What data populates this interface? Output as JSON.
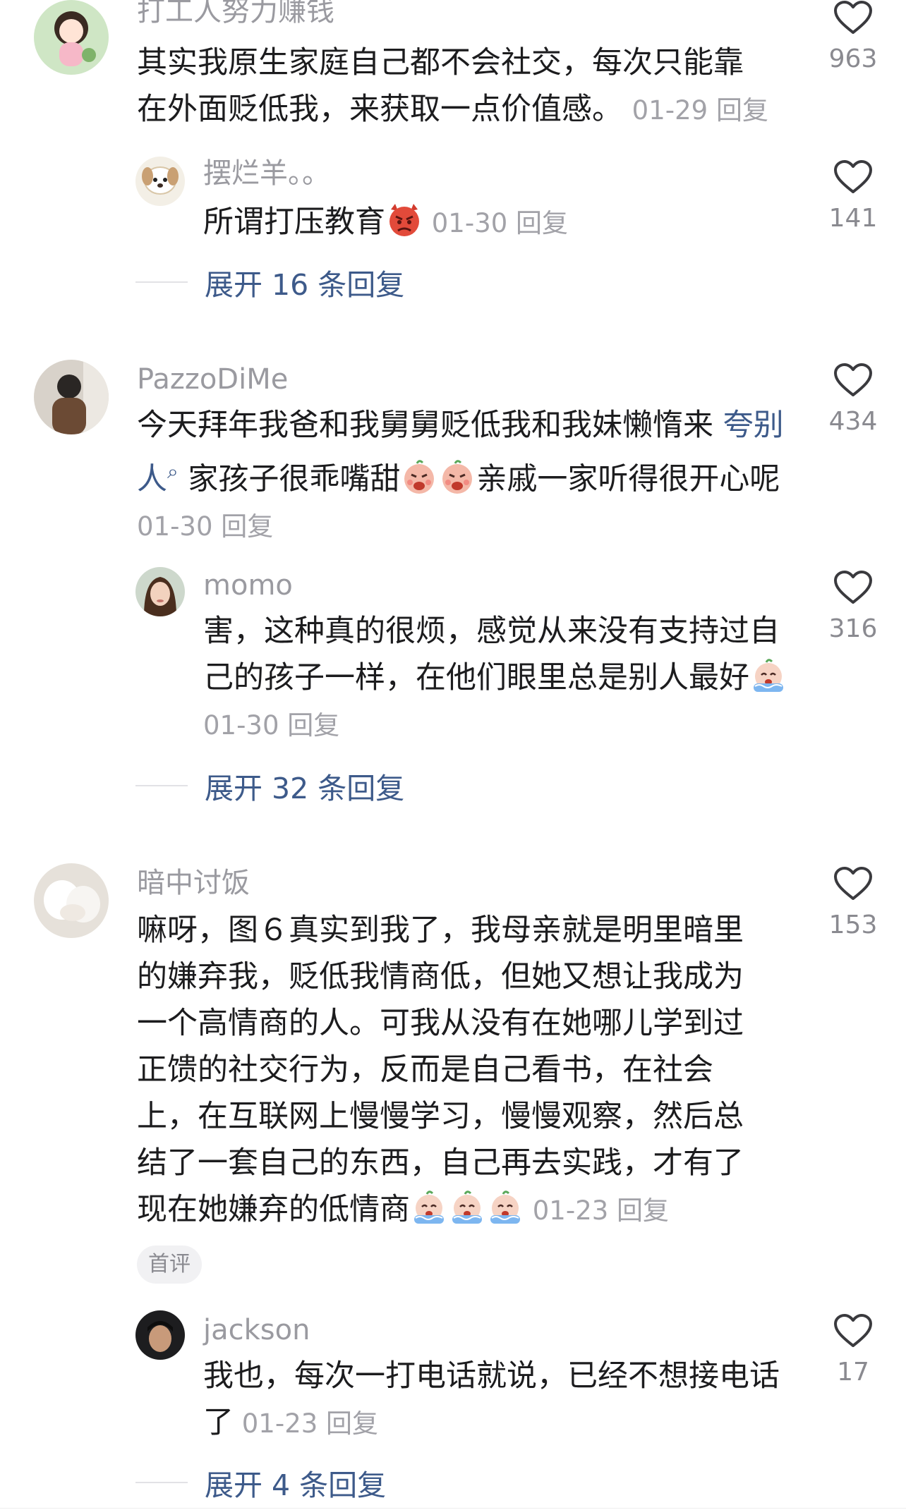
{
  "colors": {
    "accent": "#3d5a8a",
    "meta": "#a2a2a8",
    "username": "#9a9aa0"
  },
  "comments": [
    {
      "username": "打工人努力赚钱",
      "text": "其实我原生家庭自己都不会社交，每次只能靠在外面贬低我，来获取一点价值感。",
      "date": "01-29",
      "reply_label": "回复",
      "likes": "963",
      "replies": [
        {
          "username": "摆烂羊。。",
          "text": "所谓打压教育",
          "emoji": "angry-face",
          "date": "01-30",
          "reply_label": "回复",
          "likes": "141"
        }
      ],
      "expand_label": "展开 16 条回复"
    },
    {
      "username": "PazzoDiMe",
      "text_before": "今天拜年我爸和我舅舅贬低我和我妹懒惰来 ",
      "keyword": "夸别人",
      "text_after": "家孩子很乖嘴甜",
      "text_end": "亲戚一家听得很开心呢",
      "date": "01-30",
      "reply_label": "回复",
      "likes": "434",
      "replies": [
        {
          "username": "momo",
          "text": "害，这种真的很烦，感觉从来没有支持过自己的孩子一样，在他们眼里总是别人最好",
          "emoji": "crying-face",
          "date": "01-30",
          "reply_label": "回复",
          "likes": "316"
        }
      ],
      "expand_label": "展开 32 条回复"
    },
    {
      "username": "暗中讨饭",
      "text": "嘛呀，图６真实到我了，我母亲就是明里暗里的嫌弃我，贬低我情商低，但她又想让我成为一个高情商的人。可我从没有在她哪儿学到过正馈的社交行为，反而是自己看书，在社会上，在互联网上慢慢学习，慢慢观察，然后总结了一套自己的东西，自己再去实践，才有了现在她嫌弃的低情商",
      "date": "01-23",
      "reply_label": "回复",
      "likes": "153",
      "badge": "首评",
      "replies": [
        {
          "username": "jackson",
          "text": "我也，每次一打电话就说，已经不想接电话了",
          "date": "01-23",
          "reply_label": "回复",
          "likes": "17"
        }
      ],
      "expand_label": "展开 4 条回复"
    }
  ]
}
